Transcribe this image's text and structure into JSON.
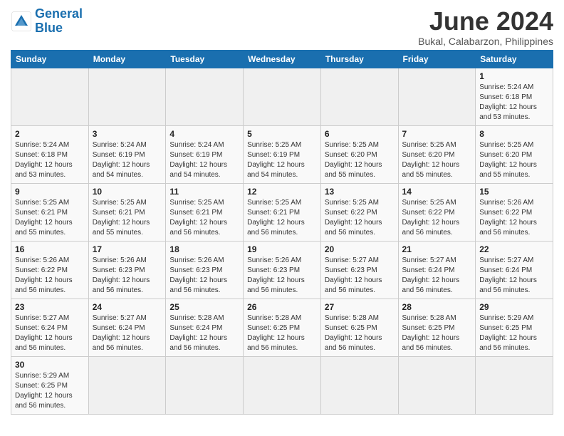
{
  "logo": {
    "text_general": "General",
    "text_blue": "Blue"
  },
  "title": "June 2024",
  "subtitle": "Bukal, Calabarzon, Philippines",
  "days_of_week": [
    "Sunday",
    "Monday",
    "Tuesday",
    "Wednesday",
    "Thursday",
    "Friday",
    "Saturday"
  ],
  "weeks": [
    [
      null,
      null,
      null,
      null,
      null,
      null,
      {
        "day": "1",
        "sunrise": "5:24 AM",
        "sunset": "6:18 PM",
        "daylight": "12 hours and 53 minutes."
      }
    ],
    [
      {
        "day": "2",
        "sunrise": "5:24 AM",
        "sunset": "6:18 PM",
        "daylight": "12 hours and 53 minutes."
      },
      {
        "day": "3",
        "sunrise": "5:24 AM",
        "sunset": "6:19 PM",
        "daylight": "12 hours and 54 minutes."
      },
      {
        "day": "4",
        "sunrise": "5:24 AM",
        "sunset": "6:19 PM",
        "daylight": "12 hours and 54 minutes."
      },
      {
        "day": "5",
        "sunrise": "5:25 AM",
        "sunset": "6:19 PM",
        "daylight": "12 hours and 54 minutes."
      },
      {
        "day": "6",
        "sunrise": "5:25 AM",
        "sunset": "6:20 PM",
        "daylight": "12 hours and 55 minutes."
      },
      {
        "day": "7",
        "sunrise": "5:25 AM",
        "sunset": "6:20 PM",
        "daylight": "12 hours and 55 minutes."
      },
      {
        "day": "8",
        "sunrise": "5:25 AM",
        "sunset": "6:20 PM",
        "daylight": "12 hours and 55 minutes."
      }
    ],
    [
      {
        "day": "9",
        "sunrise": "5:25 AM",
        "sunset": "6:21 PM",
        "daylight": "12 hours and 55 minutes."
      },
      {
        "day": "10",
        "sunrise": "5:25 AM",
        "sunset": "6:21 PM",
        "daylight": "12 hours and 55 minutes."
      },
      {
        "day": "11",
        "sunrise": "5:25 AM",
        "sunset": "6:21 PM",
        "daylight": "12 hours and 56 minutes."
      },
      {
        "day": "12",
        "sunrise": "5:25 AM",
        "sunset": "6:21 PM",
        "daylight": "12 hours and 56 minutes."
      },
      {
        "day": "13",
        "sunrise": "5:25 AM",
        "sunset": "6:22 PM",
        "daylight": "12 hours and 56 minutes."
      },
      {
        "day": "14",
        "sunrise": "5:25 AM",
        "sunset": "6:22 PM",
        "daylight": "12 hours and 56 minutes."
      },
      {
        "day": "15",
        "sunrise": "5:26 AM",
        "sunset": "6:22 PM",
        "daylight": "12 hours and 56 minutes."
      }
    ],
    [
      {
        "day": "16",
        "sunrise": "5:26 AM",
        "sunset": "6:22 PM",
        "daylight": "12 hours and 56 minutes."
      },
      {
        "day": "17",
        "sunrise": "5:26 AM",
        "sunset": "6:23 PM",
        "daylight": "12 hours and 56 minutes."
      },
      {
        "day": "18",
        "sunrise": "5:26 AM",
        "sunset": "6:23 PM",
        "daylight": "12 hours and 56 minutes."
      },
      {
        "day": "19",
        "sunrise": "5:26 AM",
        "sunset": "6:23 PM",
        "daylight": "12 hours and 56 minutes."
      },
      {
        "day": "20",
        "sunrise": "5:27 AM",
        "sunset": "6:23 PM",
        "daylight": "12 hours and 56 minutes."
      },
      {
        "day": "21",
        "sunrise": "5:27 AM",
        "sunset": "6:24 PM",
        "daylight": "12 hours and 56 minutes."
      },
      {
        "day": "22",
        "sunrise": "5:27 AM",
        "sunset": "6:24 PM",
        "daylight": "12 hours and 56 minutes."
      }
    ],
    [
      {
        "day": "23",
        "sunrise": "5:27 AM",
        "sunset": "6:24 PM",
        "daylight": "12 hours and 56 minutes."
      },
      {
        "day": "24",
        "sunrise": "5:27 AM",
        "sunset": "6:24 PM",
        "daylight": "12 hours and 56 minutes."
      },
      {
        "day": "25",
        "sunrise": "5:28 AM",
        "sunset": "6:24 PM",
        "daylight": "12 hours and 56 minutes."
      },
      {
        "day": "26",
        "sunrise": "5:28 AM",
        "sunset": "6:25 PM",
        "daylight": "12 hours and 56 minutes."
      },
      {
        "day": "27",
        "sunrise": "5:28 AM",
        "sunset": "6:25 PM",
        "daylight": "12 hours and 56 minutes."
      },
      {
        "day": "28",
        "sunrise": "5:28 AM",
        "sunset": "6:25 PM",
        "daylight": "12 hours and 56 minutes."
      },
      {
        "day": "29",
        "sunrise": "5:29 AM",
        "sunset": "6:25 PM",
        "daylight": "12 hours and 56 minutes."
      }
    ],
    [
      {
        "day": "30",
        "sunrise": "5:29 AM",
        "sunset": "6:25 PM",
        "daylight": "12 hours and 56 minutes."
      },
      null,
      null,
      null,
      null,
      null,
      null
    ]
  ]
}
